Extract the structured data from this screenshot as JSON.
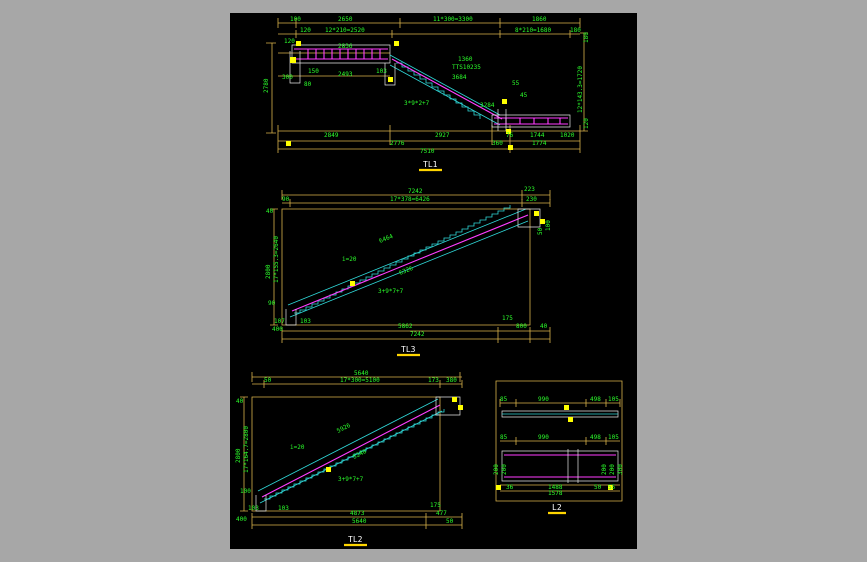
{
  "drawings": {
    "tl1": {
      "title": "TL1",
      "top_dims": [
        "100",
        "2650",
        "11*300=3300",
        "1860"
      ],
      "top_sub": [
        "120",
        "12*210=2520",
        "8*210=1680",
        "180"
      ],
      "left_dims": [
        "120",
        "2780",
        "150",
        "300",
        "80"
      ],
      "inner_dims": [
        "2836",
        "2493",
        "150",
        "103"
      ],
      "mid_labels": [
        "1360",
        "TTS10235",
        "3684",
        "55",
        "45",
        "3284",
        "3*9*2+7"
      ],
      "right_dims": [
        "180",
        "12*143.3=1720",
        "120"
      ],
      "bottom_dims": [
        "2849",
        "2927",
        "76",
        "1744",
        "1020"
      ],
      "bottom2": [
        "2776",
        "360",
        "1774"
      ],
      "total": "7510",
      "left_vert": "240"
    },
    "tl3": {
      "title": "TL3",
      "top_dims": [
        "7242",
        "223"
      ],
      "top_sub": [
        "90",
        "17*378=6426",
        "230"
      ],
      "left_dims": [
        "40",
        "2800",
        "17*155.3=2640"
      ],
      "diag": [
        "6464",
        "i=20",
        "6326",
        "3+9*7+7"
      ],
      "low_left": [
        "90",
        "107",
        "103",
        "400"
      ],
      "bottom": [
        "5862",
        "175",
        "800",
        "40"
      ],
      "total": "7242",
      "right": [
        "50",
        "100",
        "150"
      ]
    },
    "tl2": {
      "title": "TL2",
      "top_dims": [
        "5640",
        "173",
        "380"
      ],
      "top_sub": [
        "50",
        "17*300=5100"
      ],
      "left_dims": [
        "40",
        "2800",
        "17*164.7=2800"
      ],
      "diag": [
        "5926",
        "i=20",
        "5248",
        "3+9*7+7"
      ],
      "low_left": [
        "100",
        "103",
        "400",
        "103"
      ],
      "bottom": [
        "4873",
        "175",
        "477",
        "50"
      ],
      "total": "5640"
    },
    "l2": {
      "title": "L2",
      "top": [
        "85",
        "990",
        "498",
        "105"
      ],
      "mid": [
        "85",
        "990",
        "498",
        "105"
      ],
      "left": [
        "200",
        "200",
        "200"
      ],
      "right": [
        "200",
        "200",
        "300"
      ],
      "bottom": [
        "36",
        "1488",
        "50",
        "55"
      ],
      "total": "1578"
    }
  },
  "colors": {
    "sheet": "#000000",
    "frame": "#a7a7a7",
    "dimension": "#d9b24a",
    "text": "#2bff2b",
    "stair": "#2fd7d7",
    "rebar": "#ff3dff"
  }
}
